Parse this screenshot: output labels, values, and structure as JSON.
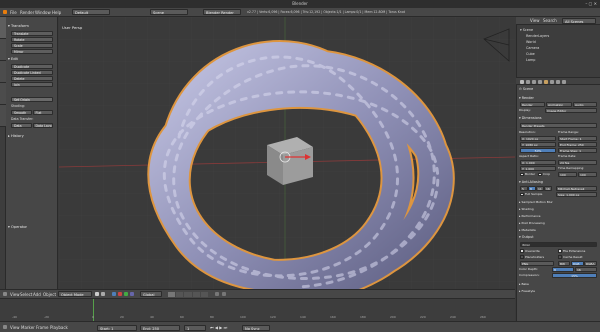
{
  "app": {
    "title": "Blender"
  },
  "menubar": {
    "menus": [
      "File",
      "Render",
      "Window",
      "Help"
    ],
    "layout_value": "Default",
    "scene_value": "Scene",
    "engine_value": "Blender Render",
    "stats": "v2.77 | Verts:6,096 | Faces:6,096 | Tris:12,192 | Objects:1/1 | Lamps:0/1 | Mem:12.80M | Torus Knot"
  },
  "toolshelf": {
    "sections": {
      "transform": "Transform",
      "edit": "Edit",
      "history": "History",
      "operator": "Operator"
    },
    "transform_buttons": [
      "Translate",
      "Rotate",
      "Scale",
      "Mirror"
    ],
    "edit_buttons": [
      "Duplicate",
      "Duplicate Linked",
      "Delete",
      "Join"
    ],
    "set_origin": "Set Origin",
    "shading_label": "Shading:",
    "shading_buttons": [
      "Smooth",
      "Flat"
    ],
    "data_transfer_label": "Data Transfer:",
    "data_buttons": [
      "Data",
      "Data Layout"
    ]
  },
  "viewport": {
    "title": "User Persp",
    "object_label": "(1) Torus Knot",
    "header_items": [
      "View",
      "Select",
      "Add",
      "Object"
    ],
    "mode": "Object Mode",
    "orientation": "Global"
  },
  "timeline": {
    "header_items": [
      "View",
      "Marker",
      "Frame",
      "Playback"
    ],
    "start_label": "Start:",
    "start_value": "1",
    "end_label": "End:",
    "end_value": "250",
    "current_frame": "1",
    "sync": "No Sync",
    "ticks": [
      "-40",
      "-20",
      "0",
      "20",
      "40",
      "60",
      "80",
      "100",
      "120",
      "140",
      "160",
      "180",
      "200",
      "220",
      "240",
      "260"
    ]
  },
  "outliner": {
    "header_items": [
      "View",
      "Search",
      "All Scenes"
    ],
    "rows": [
      "Scene",
      "RenderLayers",
      "World",
      "Camera",
      "Cube",
      "Lamp"
    ]
  },
  "properties": {
    "breadcrumb": "Scene",
    "render_header": "Render",
    "render_buttons": [
      "Render",
      "Animation",
      "Audio"
    ],
    "display_label": "Display:",
    "display_value": "Image Editor",
    "dimensions_header": "Dimensions",
    "presets": "Render Presets",
    "resolution_label": "Resolution:",
    "res_x": "X: 1920 px",
    "res_y": "Y: 1080 px",
    "res_pct": "50%",
    "frame_range_label": "Frame Range:",
    "start_frame": "Start Frame: 1",
    "end_frame": "End Frame: 250",
    "frame_step": "Frame Step: 1",
    "aspect_label": "Aspect Ratio:",
    "aspect_x": "X: 1.000",
    "aspect_y": "Y: 1.000",
    "frame_rate_label": "Frame Rate:",
    "frame_rate_value": "24 fps",
    "time_remapping": "Time Remapping:",
    "border": "Border",
    "crop": "Crop",
    "remap_old": "100",
    "remap_new": "100",
    "antialiasing": "Anti-Aliasing",
    "aa_values": [
      "5",
      "8",
      "11",
      "16"
    ],
    "aa_filter": "Mitchell-Netravali",
    "full_sample": "Full Sample",
    "aa_size": "Size: 1.000 px",
    "collapsed": [
      "Sampled Motion Blur",
      "Shading",
      "Performance",
      "Post Processing",
      "Metadata"
    ],
    "output_header": "Output",
    "output_path": "/tmp/",
    "overwrite": "Overwrite",
    "file_extensions": "File Extensions",
    "placeholders": "Placeholders",
    "cache_result": "Cache Result",
    "format_value": "PNG",
    "color_modes": [
      "BW",
      "RGB",
      "RGBA"
    ],
    "color_depth_label": "Color Depth:",
    "color_depth_values": [
      "8",
      "16"
    ],
    "compression_label": "Compression:",
    "compression_value": "15%",
    "bake_header": "Bake",
    "freestyle_header": "Freestyle"
  },
  "colors": {
    "mesh": "#a8a9cc",
    "selection_outline": "#f0a040",
    "accent_blue": "#4f7fb9"
  }
}
